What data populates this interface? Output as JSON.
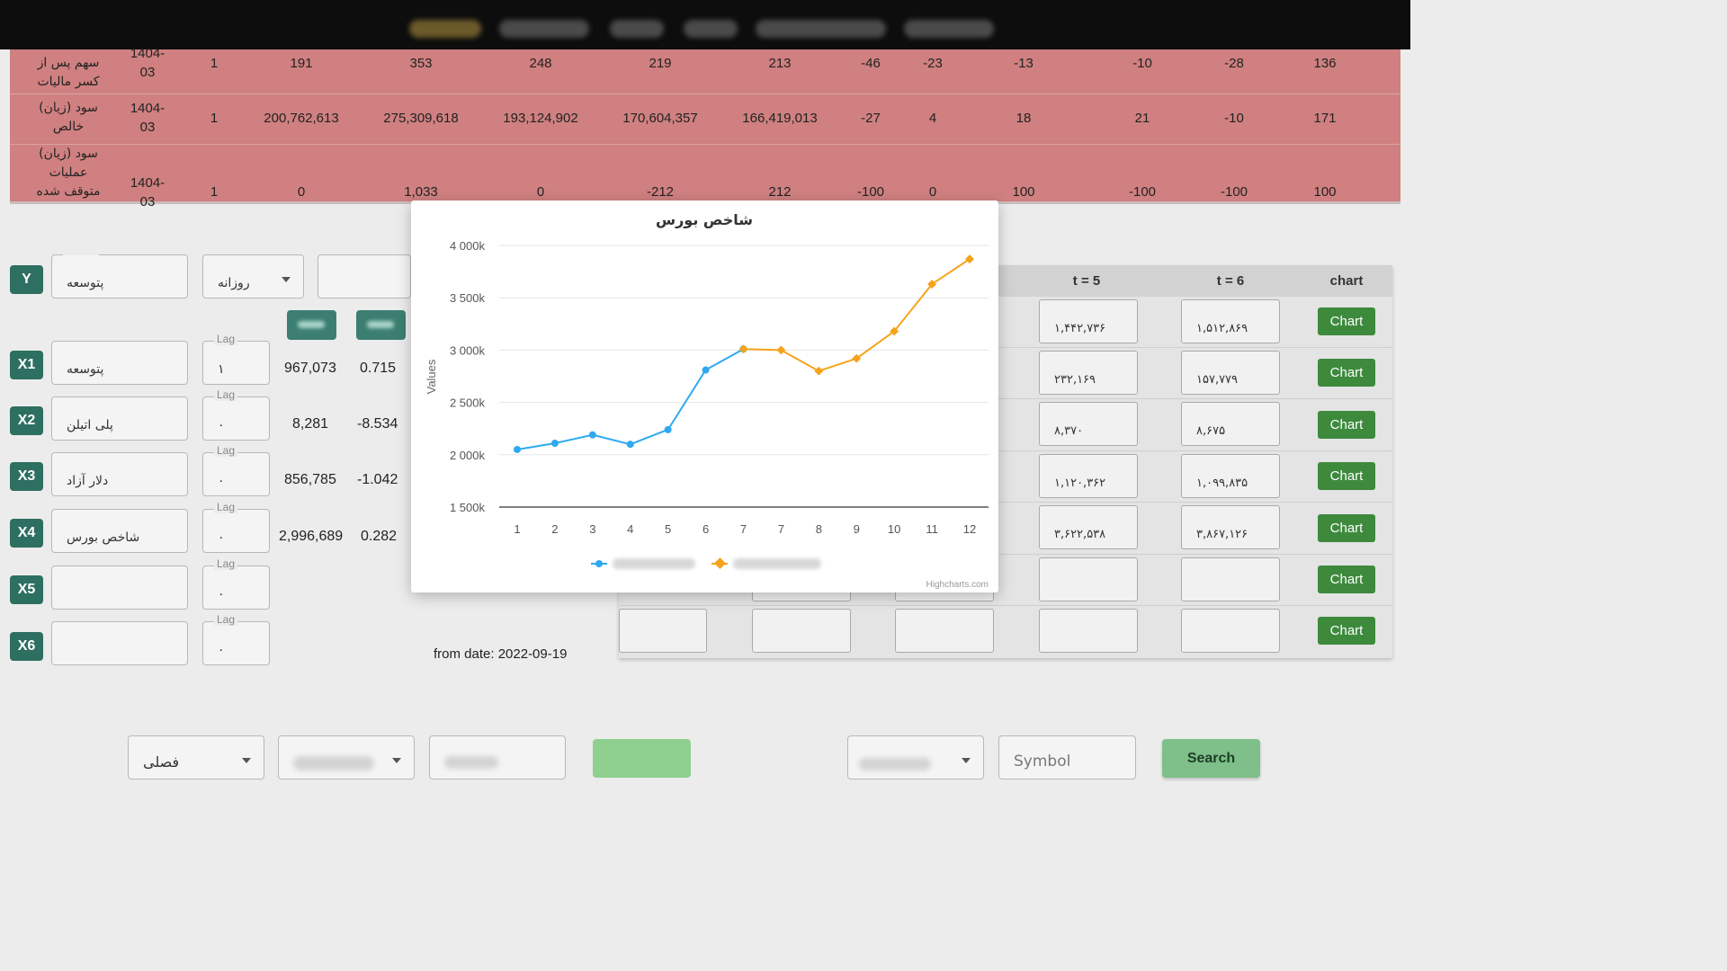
{
  "profit_table": {
    "rows": [
      {
        "label_lines": [
          "سهم پس از",
          "کسر مالیات"
        ],
        "date_lines": [
          "1404-",
          "03"
        ],
        "values": [
          "1",
          "191",
          "353",
          "248",
          "219",
          "213",
          "-46",
          "-23",
          "-13",
          "-10",
          "-28",
          "136"
        ]
      },
      {
        "label_lines": [
          "سود (زیان)",
          "خالص"
        ],
        "date_lines": [
          "1404-",
          "03"
        ],
        "values": [
          "1",
          "200,762,613",
          "275,309,618",
          "193,124,902",
          "170,604,357",
          "166,419,013",
          "-27",
          "4",
          "18",
          "21",
          "-10",
          "171"
        ]
      },
      {
        "label_lines": [
          "سود (زیان)",
          "عملیات",
          "متوقف شده"
        ],
        "date_lines": [
          "1404-",
          "03"
        ],
        "values": [
          "1",
          "0",
          "1,033",
          "0",
          "-212",
          "212",
          "-100",
          "0",
          "100",
          "-100",
          "-100",
          "100"
        ]
      }
    ]
  },
  "model": {
    "y": {
      "badge": "Y",
      "value": "پتوسعه",
      "freq": "روزانه"
    },
    "lag_label": "Lag",
    "variables": [
      {
        "badge": "X1",
        "value": "پتوسعه",
        "lag": "۱",
        "v1": "967,073",
        "v2": "0.715"
      },
      {
        "badge": "X2",
        "value": "پلی اتیلن",
        "lag": "۰",
        "v1": "8,281",
        "v2": "-8.534"
      },
      {
        "badge": "X3",
        "value": "دلار آزاد",
        "lag": "۰",
        "v1": "856,785",
        "v2": "-1.042"
      },
      {
        "badge": "X4",
        "value": "شاخص بورس",
        "lag": "۰",
        "v1": "2,996,689",
        "v2": "0.282"
      },
      {
        "badge": "X5",
        "value": "",
        "lag": "۰",
        "v1": "",
        "v2": ""
      },
      {
        "badge": "X6",
        "value": "",
        "lag": "۰",
        "v1": "",
        "v2": ""
      }
    ],
    "from_date": "from date: 2022-09-19"
  },
  "forecast_table": {
    "headers": [
      "t = 5",
      "t = 6",
      "chart"
    ],
    "rows": [
      {
        "t5": "۱,۴۴۲,۷۳۶",
        "t6": "۱,۵۱۲,۸۶۹",
        "button": "Chart"
      },
      {
        "t5": "۲۳۲,۱۶۹",
        "t6": "۱۵۷,۷۷۹",
        "button": "Chart"
      },
      {
        "t5": "۸,۳۷۰",
        "t6": "۸,۶۷۵",
        "button": "Chart"
      },
      {
        "t5": "۱,۱۲۰,۳۶۲",
        "t6": "۱,۰۹۹,۸۳۵",
        "button": "Chart"
      },
      {
        "t5": "۳,۶۲۲,۵۳۸",
        "t6": "۳,۸۶۷,۱۲۶",
        "button": "Chart"
      },
      {
        "t5": "",
        "t6": "",
        "button": "Chart"
      },
      {
        "t5": "",
        "t6": "",
        "button": "Chart"
      }
    ]
  },
  "bottom": {
    "period": "فصلی",
    "symbol_placeholder": "Symbol",
    "search_label": "Search"
  },
  "chart_data": {
    "type": "line",
    "title": "شاخص بورس",
    "ylabel": "Values",
    "xlabel": "",
    "categories": [
      "1",
      "2",
      "3",
      "4",
      "5",
      "6",
      "7",
      "7",
      "8",
      "9",
      "10",
      "11",
      "12"
    ],
    "ylim": [
      1500,
      4000
    ],
    "yticks": [
      "1 500k",
      "2 000k",
      "2 500k",
      "3 000k",
      "3 500k",
      "4 000k"
    ],
    "series": [
      {
        "color": "#2fa9ef",
        "values": [
          2050,
          2110,
          2190,
          2100,
          2240,
          2810,
          3010,
          null,
          null,
          null,
          null,
          null,
          null
        ]
      },
      {
        "color": "#f5a31c",
        "values": [
          null,
          null,
          null,
          null,
          null,
          null,
          3010,
          3000,
          2800,
          2920,
          3180,
          3630,
          3870
        ]
      }
    ],
    "credit": "Highcharts.com"
  }
}
